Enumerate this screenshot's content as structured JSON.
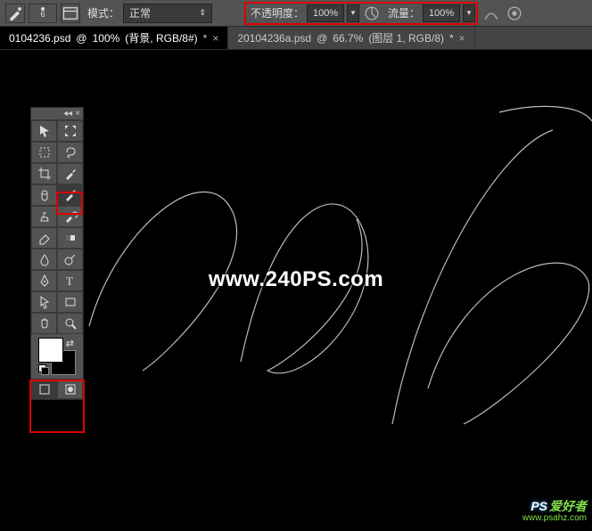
{
  "options_bar": {
    "brush_size": "6",
    "mode_label": "模式：",
    "mode_value": "正常",
    "opacity_label": "不透明度：",
    "opacity_value": "100%",
    "flow_label": "流量：",
    "flow_value": "100%"
  },
  "tabs": [
    {
      "name": "0104236.psd",
      "zoom": "100%",
      "detail": "(背景, RGB/8#)",
      "dirty": "*",
      "active": true
    },
    {
      "name": "20104236a.psd",
      "zoom": "66.7%",
      "detail": "(图层 1, RGB/8)",
      "dirty": "*",
      "active": false
    }
  ],
  "watermark": "www.240PS.com",
  "corner_watermark": {
    "prefix": "PS",
    "main": "爱好者",
    "sub": "www.psahz.com"
  },
  "tools": {
    "row1": [
      "move-tool",
      "artboard-tool"
    ],
    "row2": [
      "marquee-tool",
      "lasso-tool"
    ],
    "row3": [
      "crop-tool",
      "eyedropper-tool"
    ],
    "row4": [
      "spot-heal-tool",
      "brush-tool"
    ],
    "row5": [
      "clone-stamp-tool",
      "history-brush-tool"
    ],
    "row6": [
      "eraser-tool",
      "gradient-tool"
    ],
    "row7": [
      "blur-tool",
      "dodge-tool"
    ],
    "row8": [
      "pen-tool",
      "type-tool"
    ],
    "row9": [
      "path-select-tool",
      "rectangle-shape-tool"
    ],
    "row10": [
      "hand-tool",
      "zoom-tool"
    ]
  },
  "colors": {
    "foreground": "#ffffff",
    "background": "#000000"
  }
}
